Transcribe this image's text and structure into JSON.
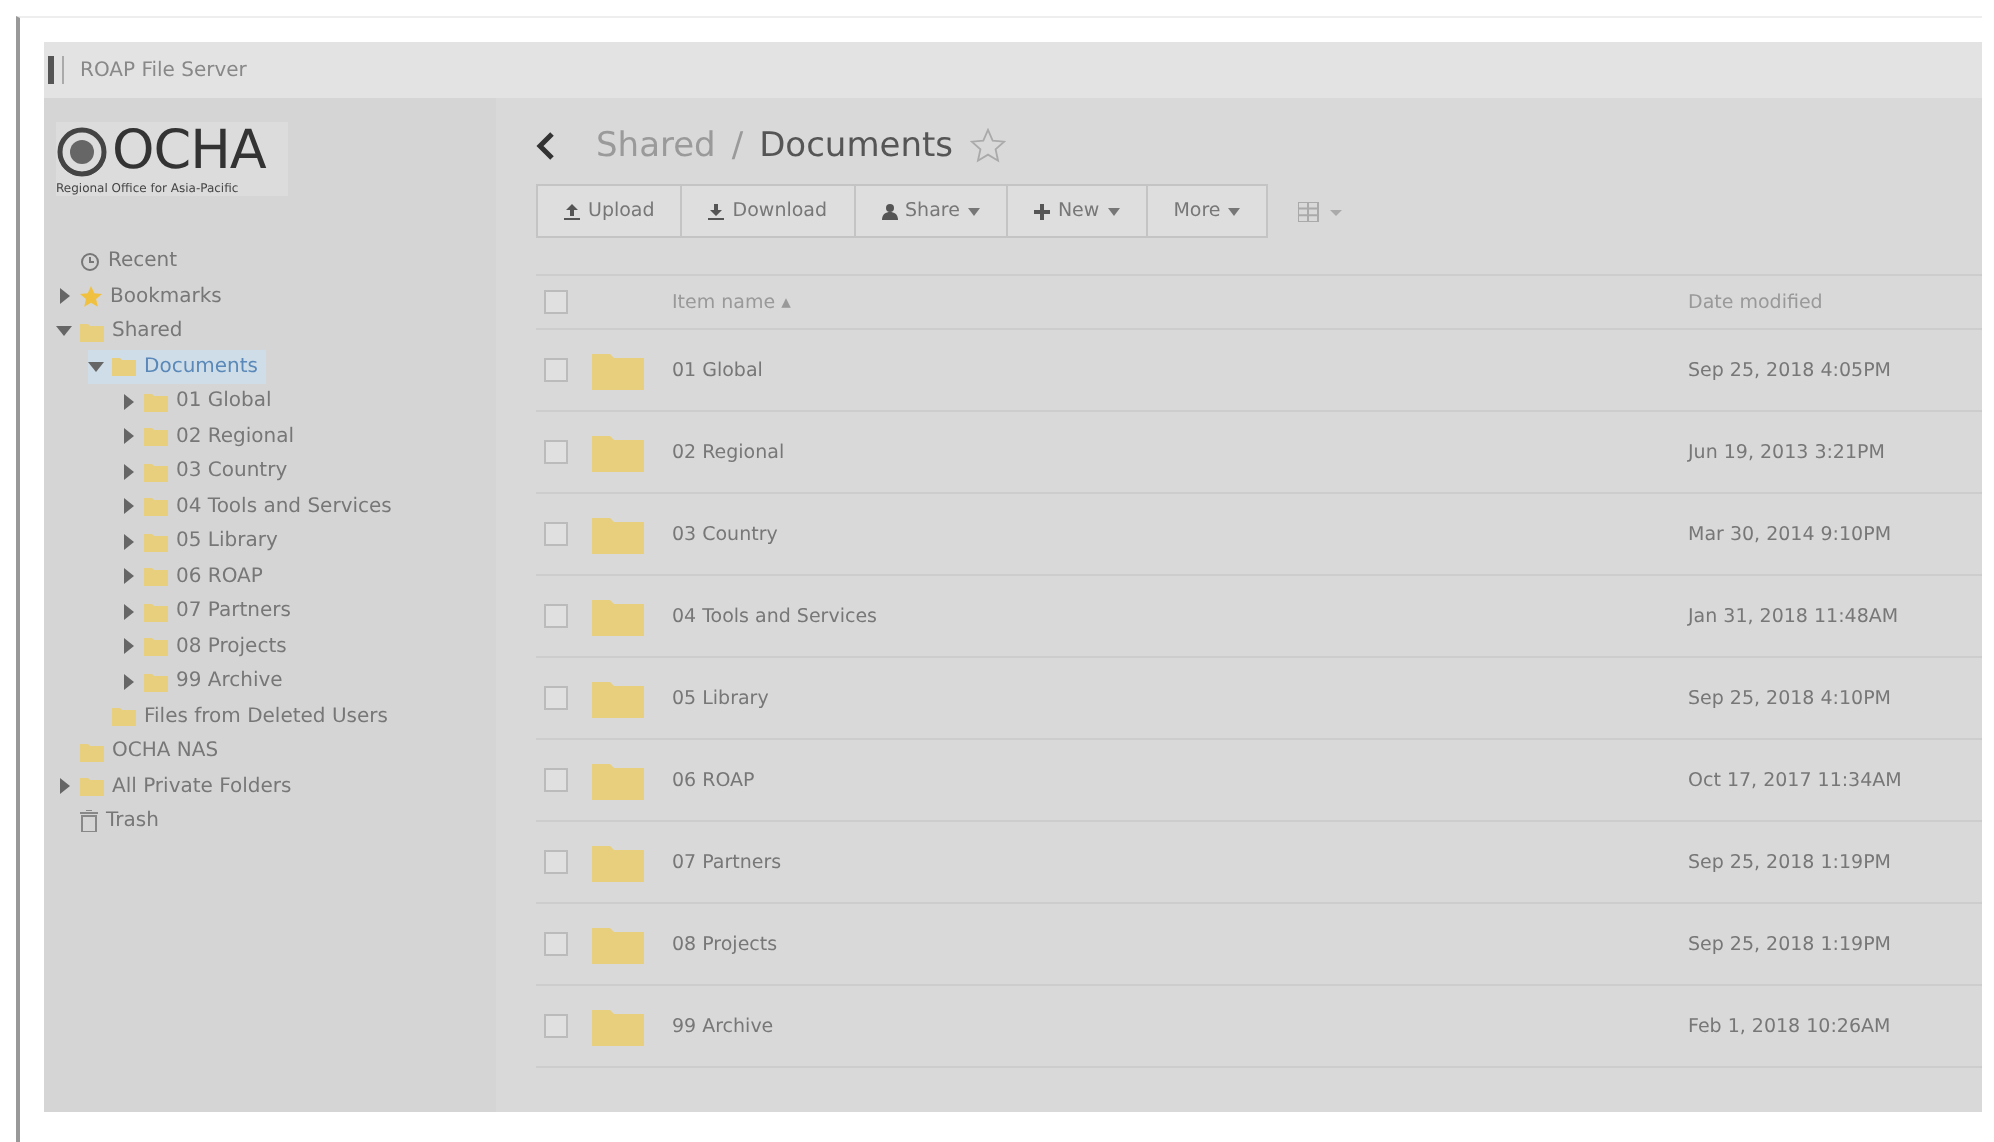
{
  "window": {
    "title": "ROAP File Server"
  },
  "logo": {
    "name": "OCHA",
    "subtitle": "Regional Office for Asia-Pacific"
  },
  "sidebar": {
    "items": [
      {
        "label": "Recent",
        "kind": "recent",
        "expandable": false,
        "selected": false
      },
      {
        "label": "Bookmarks",
        "kind": "bookmarks",
        "expandable": true,
        "expanded": false,
        "selected": false
      },
      {
        "label": "Shared",
        "kind": "folder",
        "expandable": true,
        "expanded": true,
        "selected": false,
        "children": [
          {
            "label": "Documents",
            "kind": "folder",
            "expandable": true,
            "expanded": true,
            "selected": true,
            "children": [
              {
                "label": "01 Global",
                "kind": "folder",
                "expandable": true,
                "expanded": false,
                "selected": false
              },
              {
                "label": "02 Regional",
                "kind": "folder",
                "expandable": true,
                "expanded": false,
                "selected": false
              },
              {
                "label": "03 Country",
                "kind": "folder",
                "expandable": true,
                "expanded": false,
                "selected": false
              },
              {
                "label": "04 Tools and Services",
                "kind": "folder",
                "expandable": true,
                "expanded": false,
                "selected": false
              },
              {
                "label": "05 Library",
                "kind": "folder",
                "expandable": true,
                "expanded": false,
                "selected": false
              },
              {
                "label": "06 ROAP",
                "kind": "folder",
                "expandable": true,
                "expanded": false,
                "selected": false
              },
              {
                "label": "07 Partners",
                "kind": "folder",
                "expandable": true,
                "expanded": false,
                "selected": false
              },
              {
                "label": "08 Projects",
                "kind": "folder",
                "expandable": true,
                "expanded": false,
                "selected": false
              },
              {
                "label": "99 Archive",
                "kind": "folder",
                "expandable": true,
                "expanded": false,
                "selected": false
              }
            ]
          },
          {
            "label": "Files from Deleted Users",
            "kind": "folder",
            "expandable": false,
            "selected": false
          }
        ]
      },
      {
        "label": "OCHA NAS",
        "kind": "folder",
        "expandable": false,
        "selected": false
      },
      {
        "label": "All Private Folders",
        "kind": "folder",
        "expandable": true,
        "expanded": false,
        "selected": false
      },
      {
        "label": "Trash",
        "kind": "trash",
        "expandable": false,
        "selected": false
      }
    ]
  },
  "breadcrumb": {
    "parent": "Shared",
    "separator": "/",
    "current": "Documents",
    "starred": false
  },
  "toolbar": [
    {
      "label": "Upload",
      "kind": "upload",
      "dropdown": false
    },
    {
      "label": "Download",
      "kind": "download",
      "dropdown": false
    },
    {
      "label": "Share",
      "kind": "share",
      "dropdown": true
    },
    {
      "label": "New",
      "kind": "new",
      "dropdown": true
    },
    {
      "label": "More",
      "kind": "none",
      "dropdown": true
    }
  ],
  "table": {
    "columns": [
      "Item name",
      "Date modified"
    ],
    "sort_mark": "▴",
    "all_checked": false,
    "rows": [
      {
        "name": "01 Global",
        "date": "Sep 25, 2018 4:05PM",
        "checked": false
      },
      {
        "name": "02 Regional",
        "date": "Jun 19, 2013 3:21PM",
        "checked": false
      },
      {
        "name": "03 Country",
        "date": "Mar 30, 2014 9:10PM",
        "checked": false
      },
      {
        "name": "04 Tools and Services",
        "date": "Jan 31, 2018 11:48AM",
        "checked": false
      },
      {
        "name": "05 Library",
        "date": "Sep 25, 2018 4:10PM",
        "checked": false
      },
      {
        "name": "06 ROAP",
        "date": "Oct 17, 2017 11:34AM",
        "checked": false
      },
      {
        "name": "07 Partners",
        "date": "Sep 25, 2018 1:19PM",
        "checked": false
      },
      {
        "name": "08 Projects",
        "date": "Sep 25, 2018 1:19PM",
        "checked": false
      },
      {
        "name": "99 Archive",
        "date": "Feb 1, 2018 10:26AM",
        "checked": false
      }
    ]
  }
}
